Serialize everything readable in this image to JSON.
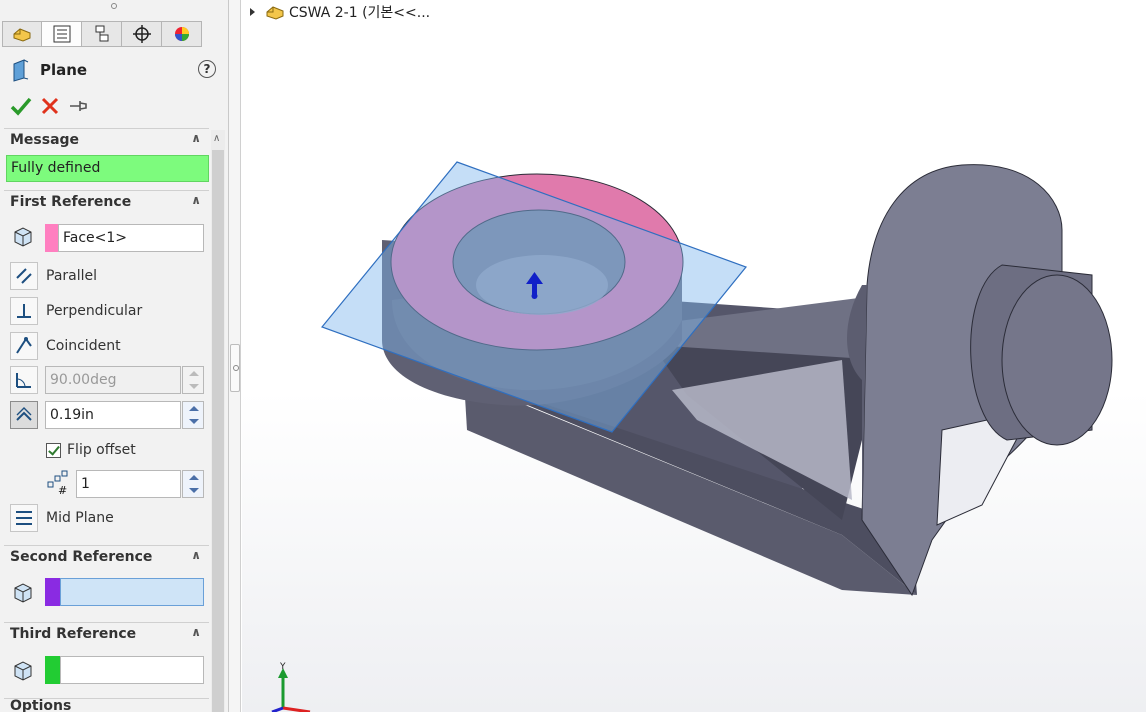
{
  "feature_manager": {
    "tabs": [
      {
        "name": "feature-tree",
        "icon": "part-icon"
      },
      {
        "name": "property-manager",
        "icon": "property-manager-icon"
      },
      {
        "name": "configuration-manager",
        "icon": "configuration-icon"
      },
      {
        "name": "dimxpert-manager",
        "icon": "crosshair-icon"
      },
      {
        "name": "display-manager",
        "icon": "appearance-icon"
      }
    ],
    "title": "Plane",
    "help": "?",
    "message": {
      "header": "Message",
      "text": "Fully defined"
    },
    "first_reference": {
      "header": "First Reference",
      "selection": "Face<1>",
      "swatch_color": "#ff7fc0",
      "parallel": "Parallel",
      "perpendicular": "Perpendicular",
      "coincident": "Coincident",
      "angle": "90.00deg",
      "offset": "0.19in",
      "flip_offset": "Flip offset",
      "flip_checked": true,
      "instances": "1",
      "mid_plane": "Mid Plane"
    },
    "second_reference": {
      "header": "Second Reference",
      "selection": "",
      "swatch_color": "#8a2be2"
    },
    "third_reference": {
      "header": "Third Reference",
      "selection": "",
      "swatch_color": "#22cc33"
    },
    "options_header": "Options"
  },
  "graphics": {
    "tree_label": "CSWA 2-1  (기본<<..."
  }
}
